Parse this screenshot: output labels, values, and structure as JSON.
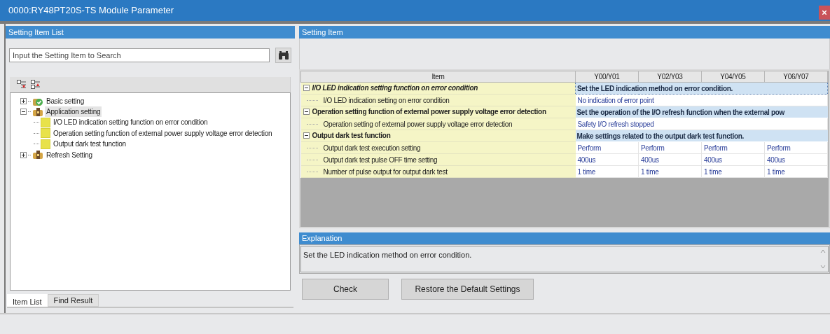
{
  "window": {
    "title": "0000:RY48PT20S-TS Module Parameter"
  },
  "left_panel": {
    "title": "Setting Item List",
    "search": {
      "placeholder": "Input the Setting Item to Search"
    },
    "tree": [
      {
        "label": "Basic setting",
        "kind": "check",
        "expanded": false,
        "selected": false
      },
      {
        "label": "Application setting",
        "kind": "folder",
        "expanded": true,
        "selected": true,
        "children": [
          {
            "label": "I/O LED indication setting function on error condition",
            "kind": "leaf",
            "selected": false
          },
          {
            "label": "Operation setting function of external power supply voltage error detection",
            "kind": "leaf",
            "selected": false
          },
          {
            "label": "Output dark test function",
            "kind": "leaf",
            "selected": false
          }
        ]
      },
      {
        "label": "Refresh Setting",
        "kind": "folder",
        "expanded": false,
        "selected": false
      }
    ],
    "tabs": [
      {
        "label": "Item List",
        "selected": true
      },
      {
        "label": "Find Result",
        "selected": false
      }
    ]
  },
  "setting_item": {
    "title": "Setting Item",
    "columns": [
      "Item",
      "Y00/Y01",
      "Y02/Y03",
      "Y04/Y05",
      "Y06/Y07"
    ],
    "groups": [
      {
        "label": "I/O LED indication setting function on error condition",
        "description": "Set the LED indication method on error condition.",
        "expanded": true,
        "selected": true,
        "rows": [
          {
            "label": "I/O LED indication setting on error condition",
            "values": [
              "No indication of error point"
            ]
          }
        ]
      },
      {
        "label": "Operation setting function of external power supply voltage error detection",
        "description": "Set the operation of the I/O refresh function when the external pow",
        "expanded": true,
        "selected": false,
        "rows": [
          {
            "label": "Operation setting of external power supply voltage error detection",
            "values": [
              "Safety I/O refresh stopped"
            ]
          }
        ]
      },
      {
        "label": "Output dark test function",
        "description": "Make settings related to the output dark test function.",
        "expanded": true,
        "selected": false,
        "rows": [
          {
            "label": "Output dark test execution setting",
            "values": [
              "Perform",
              "Perform",
              "Perform",
              "Perform"
            ]
          },
          {
            "label": "Output dark test pulse OFF time setting",
            "values": [
              "400us",
              "400us",
              "400us",
              "400us"
            ]
          },
          {
            "label": "Number of pulse output for output dark test",
            "values": [
              "1 time",
              "1 time",
              "1 time",
              "1 time"
            ]
          }
        ]
      }
    ]
  },
  "explanation": {
    "title": "Explanation",
    "text": "Set the LED indication method on error condition."
  },
  "buttons": [
    "Check",
    "Restore the Default Settings"
  ]
}
